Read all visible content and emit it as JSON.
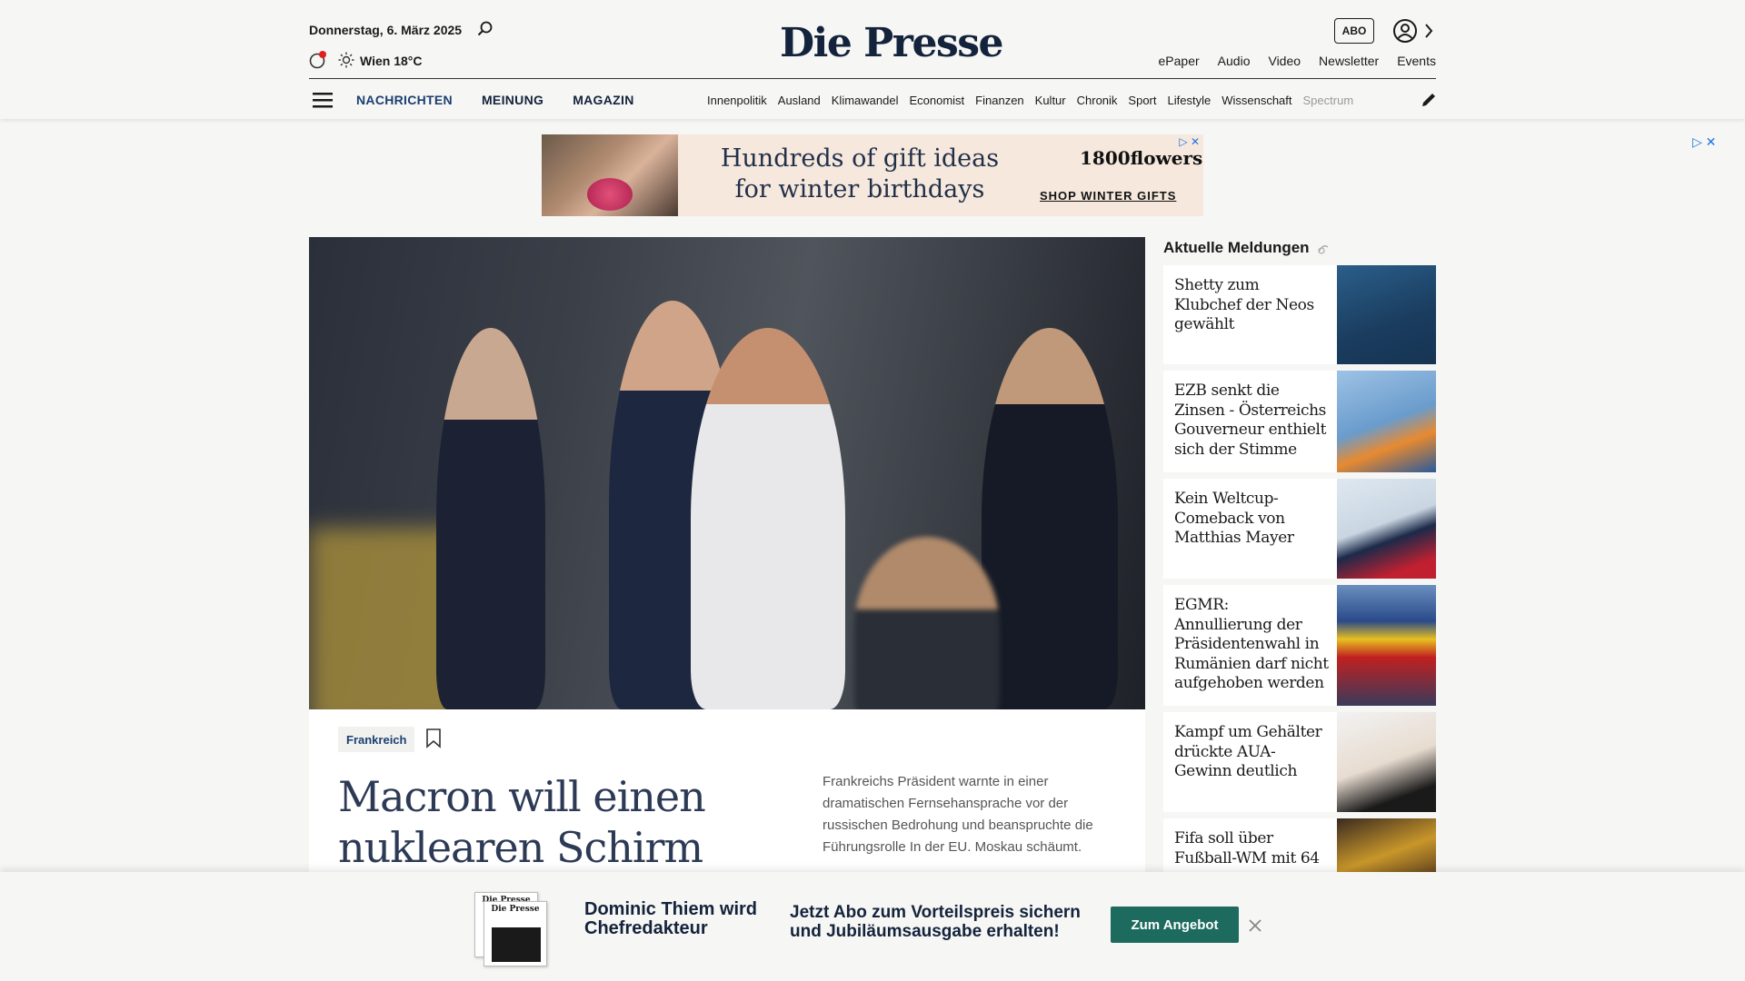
{
  "header": {
    "date": "Donnerstag, 6. März 2025",
    "weather": "Wien 18°C",
    "logo": "Die Presse",
    "abo_label": "ABO",
    "top_links": [
      "ePaper",
      "Audio",
      "Video",
      "Newsletter",
      "Events"
    ],
    "main_nav": [
      "NACHRICHTEN",
      "MEINUNG",
      "MAGAZIN"
    ],
    "sub_nav": [
      "Innenpolitik",
      "Ausland",
      "Klimawandel",
      "Economist",
      "Finanzen",
      "Kultur",
      "Chronik",
      "Sport",
      "Lifestyle",
      "Wissenschaft",
      "Spectrum"
    ]
  },
  "ad": {
    "headline_line1": "Hundreds of gift ideas",
    "headline_line2": "for winter birthdays",
    "brand": "1800flowers.com",
    "cta": "SHOP WINTER GIFTS"
  },
  "hero": {
    "tag": "Frankreich",
    "headline": "Macron will einen nuklearen Schirm für",
    "teaser": "Frankreichs Präsident warnte in einer dramatischen Fernsehansprache vor der russischen Bedrohung und beanspruchte die Führungsrolle In der EU. Moskau schäumt."
  },
  "sidebar": {
    "title": "Aktuelle Meldungen",
    "items": [
      {
        "title": "Shetty zum Klubchef der Neos gewählt"
      },
      {
        "title": "EZB senkt die Zinsen - Österreichs Gouverneur enthielt sich der Stimme"
      },
      {
        "title": "Kein Weltcup-Comeback von Matthias Mayer"
      },
      {
        "title": "EGMR: Annullierung der Präsidentenwahl in Rumänien darf nicht aufgehoben werden"
      },
      {
        "title": "Kampf um Gehälter drückte AUA-Gewinn deutlich"
      },
      {
        "title": "Fifa soll über Fußball-WM mit 64"
      }
    ]
  },
  "promo": {
    "paper_label": "Die Presse",
    "name": "Dominic Thiem wird Chefredakteur",
    "text": "Jetzt Abo zum Vorteilspreis sichern und Jubiläumsausgabe erhalten!",
    "button": "Zum Angebot"
  },
  "colors": {
    "navy": "#14233c",
    "link_blue": "#1b3f72",
    "promo_green": "#1d6b5e",
    "notification_red": "#e02020"
  }
}
